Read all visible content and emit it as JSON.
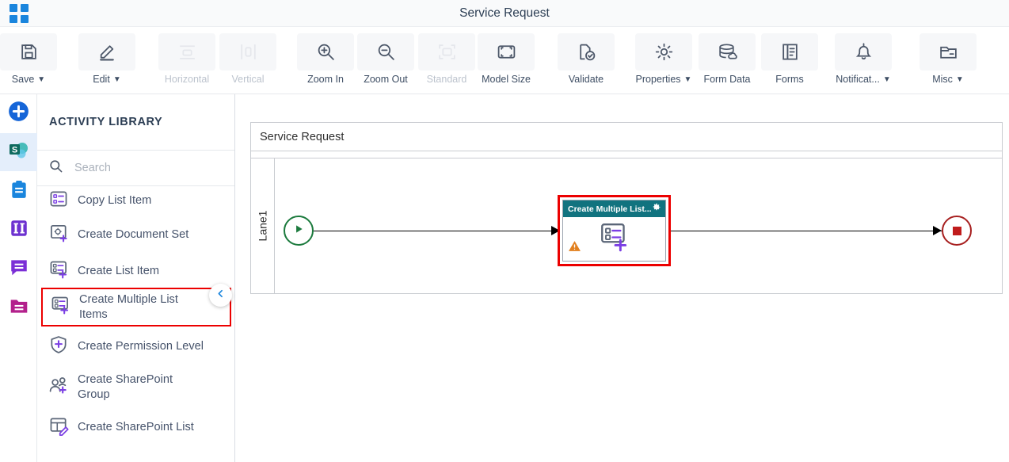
{
  "titlebar": {
    "app_grid_icon": "app-grid-icon",
    "title": "Service Request"
  },
  "toolbar": {
    "items": [
      {
        "label": "Save",
        "icon": "save-icon",
        "caret": "⌄",
        "disabled": false
      },
      {
        "label": "Edit",
        "icon": "pencil-icon",
        "caret": "⌄",
        "disabled": false
      },
      {
        "label": "Horizontal",
        "icon": "horizontal-icon",
        "caret": "",
        "disabled": true
      },
      {
        "label": "Vertical",
        "icon": "vertical-icon",
        "caret": "",
        "disabled": true
      },
      {
        "label": "Zoom In",
        "icon": "zoom-in-icon",
        "caret": "",
        "disabled": false
      },
      {
        "label": "Zoom Out",
        "icon": "zoom-out-icon",
        "caret": "",
        "disabled": false
      },
      {
        "label": "Standard",
        "icon": "standard-icon",
        "caret": "",
        "disabled": true
      },
      {
        "label": "Model Size",
        "icon": "model-size-icon",
        "caret": "",
        "disabled": false
      },
      {
        "label": "Validate",
        "icon": "validate-icon",
        "caret": "",
        "disabled": false
      },
      {
        "label": "Properties",
        "icon": "gear-icon",
        "caret": "⌄",
        "disabled": false
      },
      {
        "label": "Form Data",
        "icon": "database-icon",
        "caret": "",
        "disabled": false
      },
      {
        "label": "Forms",
        "icon": "forms-icon",
        "caret": "",
        "disabled": false
      },
      {
        "label": "Notificat...",
        "icon": "bell-icon",
        "caret": "⌄",
        "disabled": false
      },
      {
        "label": "Misc",
        "icon": "folder-icon",
        "caret": "⌄",
        "disabled": false
      }
    ]
  },
  "rail": {
    "items": [
      {
        "name": "add-icon",
        "active": false
      },
      {
        "name": "sharepoint-icon",
        "active": true
      },
      {
        "name": "clipboard-icon",
        "active": false
      },
      {
        "name": "columns-icon",
        "active": false
      },
      {
        "name": "chat-icon",
        "active": false
      },
      {
        "name": "folder-list-icon",
        "active": false
      }
    ]
  },
  "library": {
    "header": "ACTIVITY LIBRARY",
    "search": {
      "value": "",
      "placeholder": "Search",
      "icon": "search-icon"
    },
    "collapse_handle_icon": "chevron-left-icon",
    "items": [
      {
        "label": "Copy List Item",
        "icon": "copy-list-item-icon",
        "selected": false
      },
      {
        "label": "Create Document Set",
        "icon": "create-document-set-icon",
        "selected": false
      },
      {
        "label": "Create List Item",
        "icon": "create-list-item-icon",
        "selected": false
      },
      {
        "label": "Create Multiple List Items",
        "icon": "create-multiple-list-items-icon",
        "selected": true
      },
      {
        "label": "Create Permission Level",
        "icon": "create-permission-level-icon",
        "selected": false
      },
      {
        "label": "Create SharePoint Group",
        "icon": "create-sharepoint-group-icon",
        "selected": false
      },
      {
        "label": "Create SharePoint List",
        "icon": "create-sharepoint-list-icon",
        "selected": false
      }
    ]
  },
  "canvas": {
    "pool_title": "Service Request",
    "lane_label": "Lane1",
    "start_node": {
      "name": "start-event",
      "icon": "play-icon"
    },
    "end_node": {
      "name": "end-event",
      "icon": "stop-icon"
    },
    "activity": {
      "header_label": "Create Multiple List...",
      "gear_icon": "gear-icon",
      "warning_icon": "warning-icon",
      "body_icon": "create-multiple-list-items-icon",
      "selected": true
    }
  },
  "colors": {
    "accent_blue": "#1a85dd",
    "selection_red": "#ec0000",
    "activity_header_teal": "#11737f",
    "start_green": "#1b7a3d",
    "end_red": "#a71f1f",
    "warning_orange": "#e2801f",
    "icon_purple": "#7b3fe4",
    "icon_slate": "#5b6678"
  }
}
